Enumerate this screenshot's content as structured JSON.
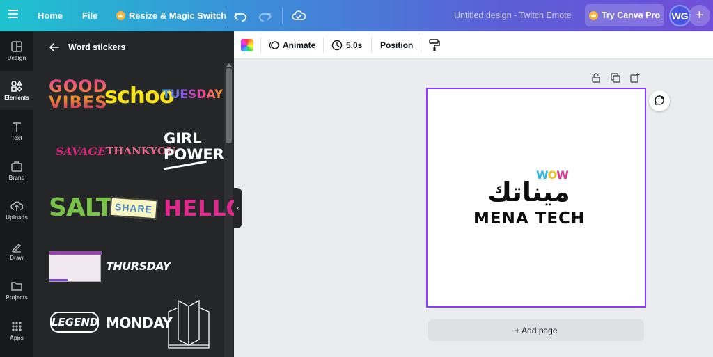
{
  "topbar": {
    "home_label": "Home",
    "file_label": "File",
    "resize_label": "Resize & Magic Switch",
    "doc_title": "Untitled design - Twitch Emote",
    "try_pro_label": "Try Canva Pro",
    "avatar_initials": "WG",
    "add_label": "+"
  },
  "rail": {
    "items": [
      {
        "label": "Design",
        "icon": "design-icon"
      },
      {
        "label": "Elements",
        "icon": "elements-icon"
      },
      {
        "label": "Text",
        "icon": "text-icon"
      },
      {
        "label": "Brand",
        "icon": "brand-icon"
      },
      {
        "label": "Uploads",
        "icon": "uploads-icon"
      },
      {
        "label": "Draw",
        "icon": "draw-icon"
      },
      {
        "label": "Projects",
        "icon": "projects-icon"
      },
      {
        "label": "Apps",
        "icon": "apps-icon"
      }
    ]
  },
  "panel": {
    "title": "Word stickers",
    "stickers": {
      "good_vibes_1": "GOOD",
      "good_vibes_2": "VIBES",
      "schoo": "schoo",
      "tuesday": "TUESDAY",
      "savage": "SAVAGE",
      "thankyou": "THANKYOU",
      "girl": "GIRL",
      "power": "POWER",
      "salty": "SALTY",
      "share": "SHARE",
      "hello": "HELLO",
      "thursday": "THURSDAY",
      "legend": "LEGEND",
      "monday": "MONDAY"
    }
  },
  "editor_toolbar": {
    "animate_label": "Animate",
    "duration_label": "5.0s",
    "position_label": "Position"
  },
  "canvas": {
    "logo_wow": [
      "W",
      "O",
      "W"
    ],
    "logo_arabic": "ميناتك",
    "logo_latin": "MENA TECH",
    "add_page_label": "+ Add page"
  },
  "colors": {
    "selection": "#8b3dff",
    "rail_bg": "#18191b",
    "panel_bg": "#252627"
  }
}
